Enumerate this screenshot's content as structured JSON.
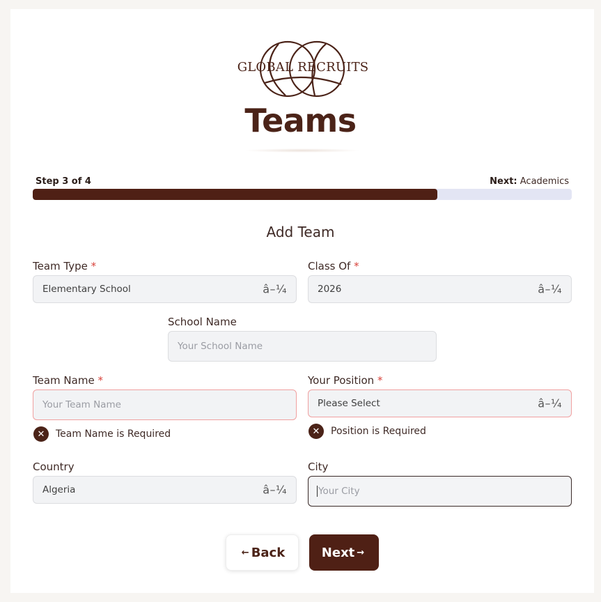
{
  "brand": {
    "logo_text": "GLOBAL RECRUITS"
  },
  "page": {
    "title": "Teams"
  },
  "progress": {
    "step_label": "Step 3 of 4",
    "next_prefix": "Next:",
    "next_name": "Academics",
    "value": 0.75
  },
  "form": {
    "section_title": "Add Team",
    "required_mark": "*",
    "select_arrow": "â–¼",
    "team_type": {
      "label": "Team Type",
      "value": "Elementary School"
    },
    "class_of": {
      "label": "Class Of",
      "value": "2026"
    },
    "school_name": {
      "label": "School Name",
      "placeholder": "Your School Name"
    },
    "team_name": {
      "label": "Team Name",
      "placeholder": "Your Team Name",
      "error": "Team Name is Required"
    },
    "position": {
      "label": "Your Position",
      "value": "Please Select",
      "error": "Position is Required"
    },
    "country": {
      "label": "Country",
      "value": "Algeria"
    },
    "city": {
      "label": "City",
      "placeholder": "Your City"
    },
    "error_icon": "✕"
  },
  "buttons": {
    "back_arrow": "←",
    "back": "Back",
    "next": "Next",
    "next_arrow": "→"
  },
  "colors": {
    "brand": "#4f2015",
    "progress_track": "#e3e5f4",
    "required": "#d9443c",
    "error_border": "#f0a0a0"
  }
}
